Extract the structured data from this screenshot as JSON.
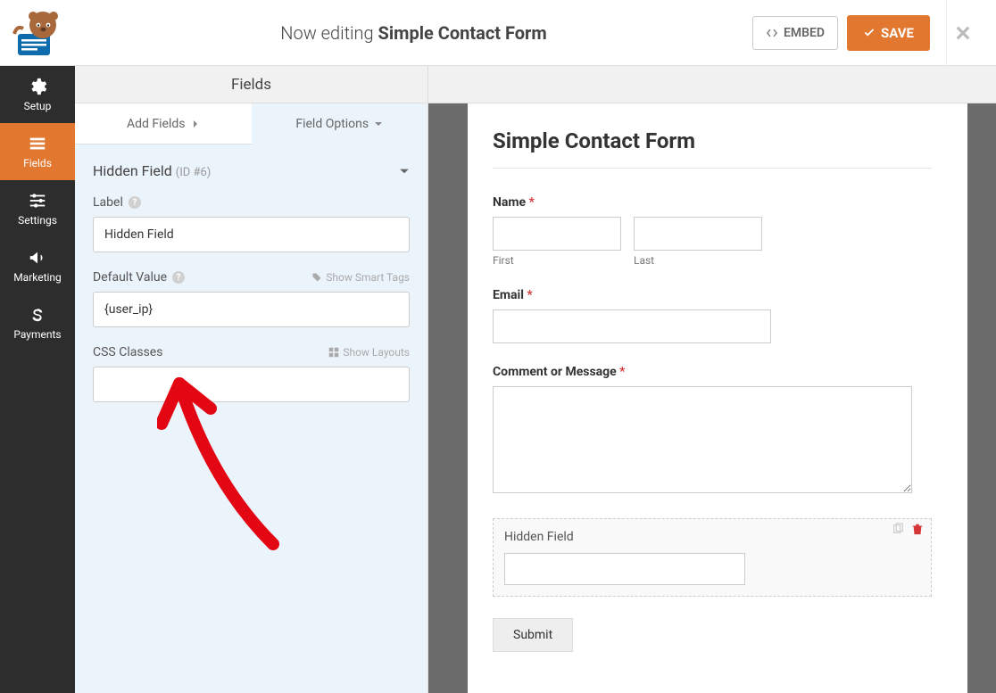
{
  "header": {
    "editing_prefix": "Now editing ",
    "editing_title": "Simple Contact Form",
    "embed_label": "EMBED",
    "save_label": "SAVE"
  },
  "nav": {
    "items": [
      {
        "key": "setup",
        "label": "Setup"
      },
      {
        "key": "fields",
        "label": "Fields"
      },
      {
        "key": "settings",
        "label": "Settings"
      },
      {
        "key": "marketing",
        "label": "Marketing"
      },
      {
        "key": "payments",
        "label": "Payments"
      }
    ]
  },
  "panel": {
    "header": "Fields",
    "tabs": {
      "add": "Add Fields",
      "options": "Field Options"
    },
    "section": {
      "name": "Hidden Field",
      "id": "(ID #6)"
    },
    "label_field": {
      "label": "Label",
      "value": "Hidden Field"
    },
    "default_field": {
      "label": "Default Value",
      "hint": "Show Smart Tags",
      "value": "{user_ip}"
    },
    "css_field": {
      "label": "CSS Classes",
      "hint": "Show Layouts",
      "value": ""
    }
  },
  "preview": {
    "title": "Simple Contact Form",
    "name": {
      "label": "Name",
      "first_sub": "First",
      "last_sub": "Last"
    },
    "email": {
      "label": "Email"
    },
    "comment": {
      "label": "Comment or Message"
    },
    "hidden": {
      "label": "Hidden Field"
    },
    "submit": "Submit"
  }
}
